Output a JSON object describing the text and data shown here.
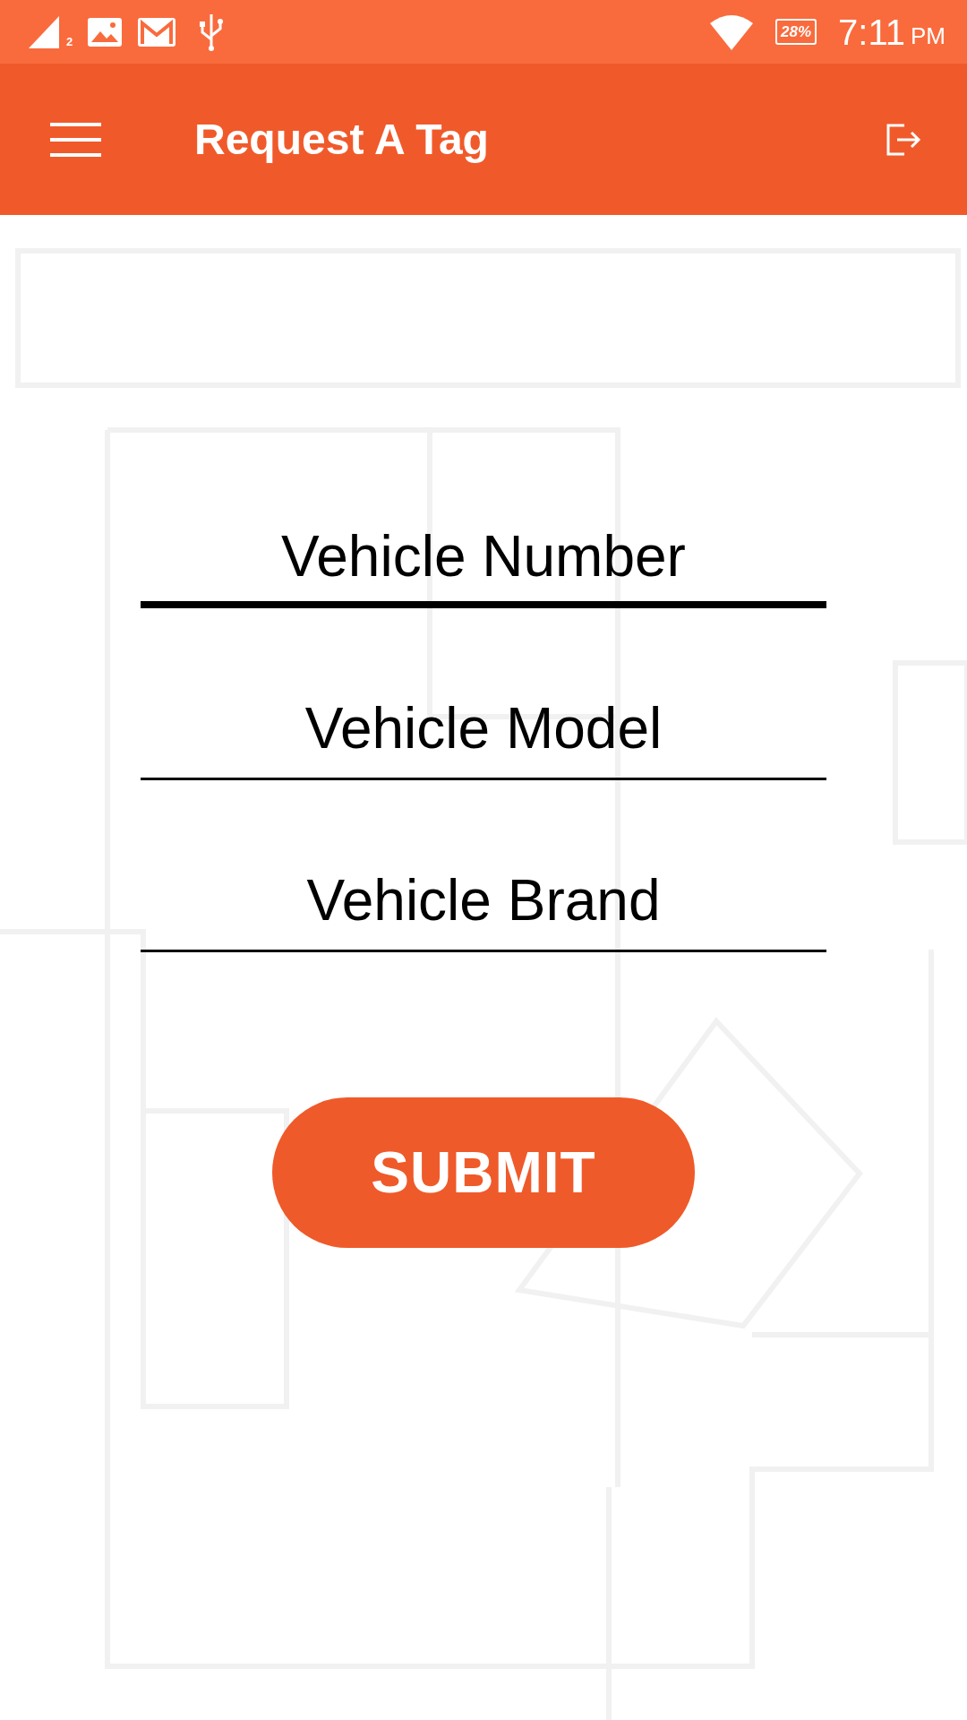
{
  "status_bar": {
    "signal_label": "2",
    "battery": "28%",
    "time": "7:11",
    "period": "PM"
  },
  "app_bar": {
    "title": "Request A Tag"
  },
  "fields": [
    {
      "placeholder": "Vehicle Number",
      "focused": true
    },
    {
      "placeholder": "Vehicle Model",
      "focused": false
    },
    {
      "placeholder": "Vehicle Brand",
      "focused": false
    }
  ],
  "submit_button": "SUBMIT"
}
